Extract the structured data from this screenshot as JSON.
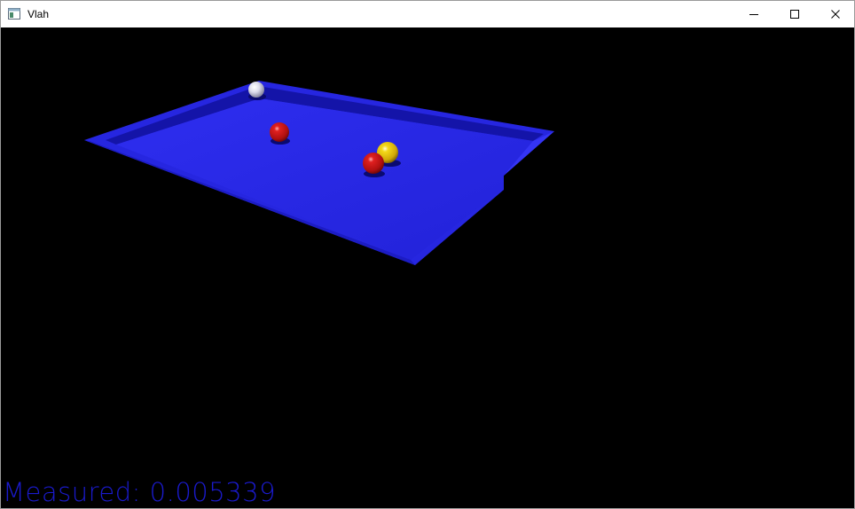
{
  "window": {
    "title": "Vlah",
    "icon": "app-window-icon",
    "controls": [
      "minimize-icon",
      "maximize-icon",
      "close-icon"
    ]
  },
  "hud": {
    "measured_label": "Measured:",
    "measured_value": "0.005339",
    "color": "#1a1acc"
  },
  "scene": {
    "background": "#000000",
    "table_color": "#2a2ae6",
    "balls": [
      {
        "color": "white",
        "hex": "#e8e8f4"
      },
      {
        "color": "red",
        "hex": "#c81414"
      },
      {
        "color": "yellow",
        "hex": "#f0d214"
      },
      {
        "color": "red",
        "hex": "#c81414"
      }
    ]
  }
}
